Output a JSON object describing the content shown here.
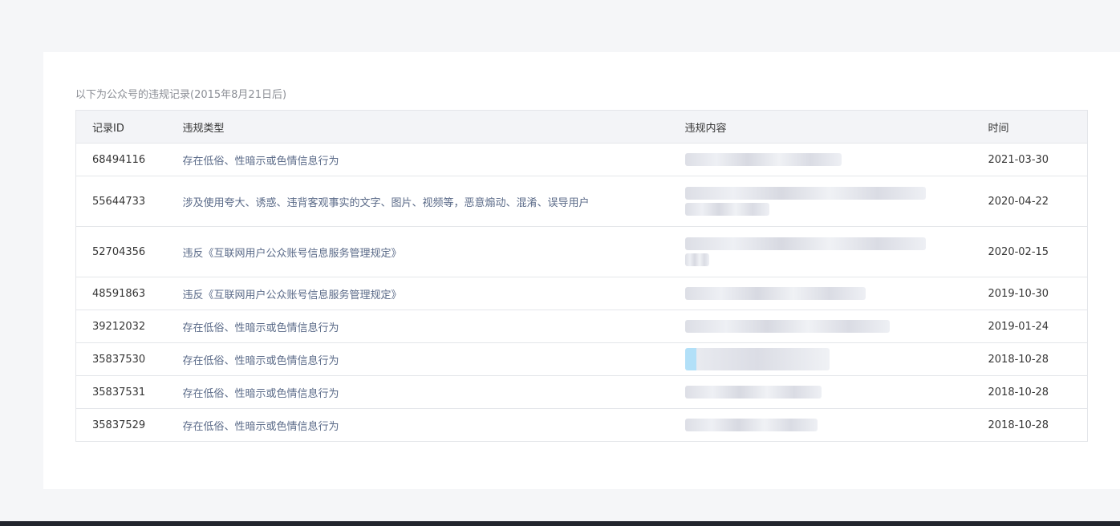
{
  "caption": "以下为公众号的违规记录(2015年8月21日后)",
  "table": {
    "headers": {
      "id": "记录ID",
      "type": "违规类型",
      "content": "违规内容",
      "time": "时间"
    },
    "rows": [
      {
        "id": "68494116",
        "type": "存在低俗、性暗示或色情信息行为",
        "time": "2021-03-30"
      },
      {
        "id": "55644733",
        "type": "涉及使用夸大、诱惑、违背客观事实的文字、图片、视频等，恶意煽动、混淆、误导用户",
        "time": "2020-04-22"
      },
      {
        "id": "52704356",
        "type": "违反《互联网用户公众账号信息服务管理规定》",
        "time": "2020-02-15"
      },
      {
        "id": "48591863",
        "type": "违反《互联网用户公众账号信息服务管理规定》",
        "time": "2019-10-30"
      },
      {
        "id": "39212032",
        "type": "存在低俗、性暗示或色情信息行为",
        "time": "2019-01-24"
      },
      {
        "id": "35837530",
        "type": "存在低俗、性暗示或色情信息行为",
        "time": "2018-10-28"
      },
      {
        "id": "35837531",
        "type": "存在低俗、性暗示或色情信息行为",
        "time": "2018-10-28"
      },
      {
        "id": "35837529",
        "type": "存在低俗、性暗示或色情信息行为",
        "time": "2018-10-28"
      }
    ]
  },
  "colors": {
    "page_bg": "#f5f6f8",
    "card_bg": "#ffffff",
    "header_bg": "#f3f4f7",
    "type_text": "#5a6a88",
    "bottom_bar": "#22252d"
  }
}
